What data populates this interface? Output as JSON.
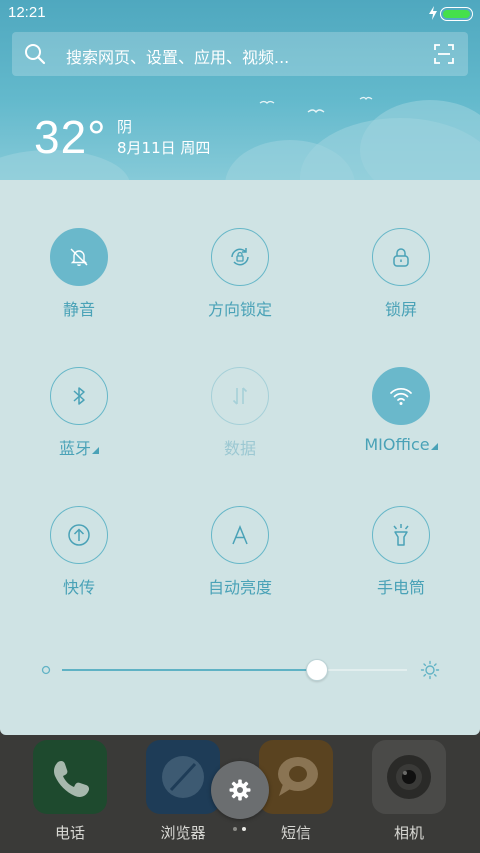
{
  "status_bar": {
    "time": "12:21",
    "battery_level": 1.0,
    "battery_color": "#45e04a",
    "charging_icon": "bolt-icon"
  },
  "search": {
    "placeholder": "搜索网页、设置、应用、视频...",
    "search_icon": "search-icon",
    "scan_icon": "scan-icon"
  },
  "weather": {
    "temperature": "32°",
    "condition": "阴",
    "date": "8月11日 周四"
  },
  "quick_settings": {
    "accent_color": "#6ab8cb",
    "tiles": [
      {
        "label": "静音",
        "icon": "bell-off-icon",
        "state": "on"
      },
      {
        "label": "方向锁定",
        "icon": "rotation-lock-icon",
        "state": "off"
      },
      {
        "label": "锁屏",
        "icon": "lock-icon",
        "state": "off"
      },
      {
        "label": "蓝牙",
        "icon": "bluetooth-icon",
        "state": "off",
        "has_submenu": true
      },
      {
        "label": "数据",
        "icon": "mobile-data-icon",
        "state": "disabled"
      },
      {
        "label": "MIOffice",
        "icon": "wifi-icon",
        "state": "on",
        "has_submenu": true
      },
      {
        "label": "快传",
        "icon": "share-upload-icon",
        "state": "off"
      },
      {
        "label": "自动亮度",
        "icon": "auto-brightness-icon",
        "state": "off"
      },
      {
        "label": "手电筒",
        "icon": "flashlight-icon",
        "state": "off"
      }
    ],
    "brightness": {
      "level": 0.74,
      "min_icon": "dim-icon",
      "max_icon": "brightness-icon"
    }
  },
  "dock": {
    "apps": [
      {
        "label": "电话",
        "icon": "phone-icon",
        "color": "#1e4a2e"
      },
      {
        "label": "浏览器",
        "icon": "browser-icon",
        "color": "#1e3c57"
      },
      {
        "label": "短信",
        "icon": "message-icon",
        "color": "#5a4320"
      },
      {
        "label": "相机",
        "icon": "camera-icon",
        "color": "#4a4a48"
      }
    ],
    "settings_icon": "gear-icon",
    "page_indicator": {
      "pages": 2,
      "current": 2
    }
  }
}
